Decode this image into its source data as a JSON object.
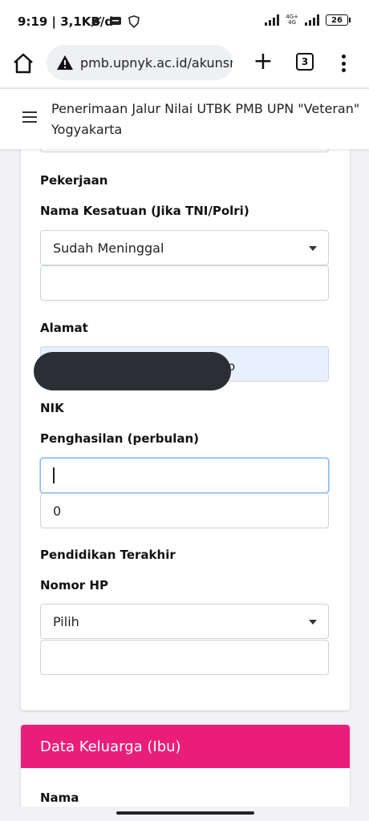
{
  "status": {
    "time": "9:19 | 3,1KB/d",
    "net_label_top": "4G+",
    "net_label_bottom": "4G",
    "battery": "26"
  },
  "browser": {
    "url": "pmb.upnyk.ac.id/akunsm",
    "tab_count": "3",
    "icons": [
      "home-icon",
      "warning-icon",
      "plus-icon",
      "tabs-icon",
      "menu-icon"
    ]
  },
  "header": {
    "title": "Penerimaan Jalur Nilai UTBK PMB UPN \"Veteran\" Yogyakarta"
  },
  "form": {
    "pekerjaan_label": "Pekerjaan",
    "kesatuan_label": "Nama Kesatuan (Jika TNI/Polri)",
    "kesatuan_select": "Sudah Meninggal",
    "kesatuan_input": "",
    "alamat_label": "Alamat",
    "alamat_visible_tail": "o",
    "nik_label": "NIK",
    "penghasilan_label": "Penghasilan (perbulan)",
    "penghasilan_input": "",
    "penghasilan_value": "0",
    "pendidikan_label": "Pendidikan Terakhir",
    "nomor_hp_label": "Nomor HP",
    "nomor_hp_select": "Pilih",
    "nomor_hp_input": ""
  },
  "section2": {
    "title": "Data Keluarga (Ibu)",
    "first_label": "Nama"
  },
  "colors": {
    "section_header": "#e91e7a",
    "autofill_bg": "#e8f0fe",
    "focus_border": "#86b7fe"
  }
}
